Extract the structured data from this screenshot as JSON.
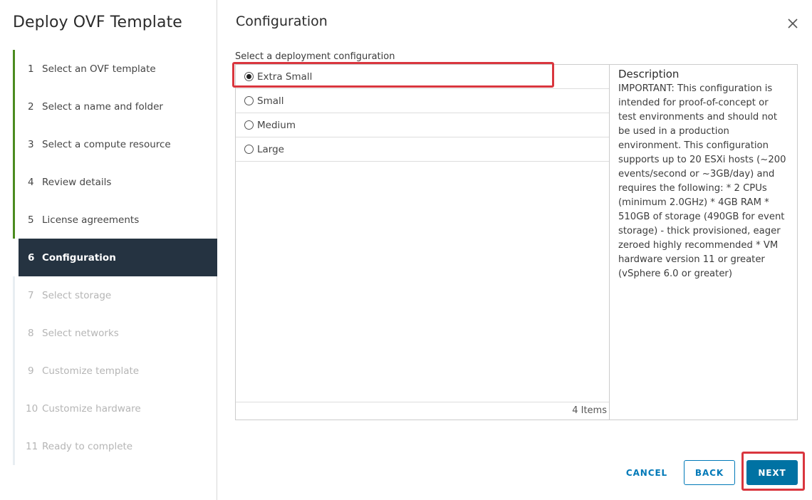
{
  "wizard": {
    "title": "Deploy OVF Template",
    "steps": [
      {
        "num": "1",
        "label": "Select an OVF template",
        "state": "done"
      },
      {
        "num": "2",
        "label": "Select a name and folder",
        "state": "done"
      },
      {
        "num": "3",
        "label": "Select a compute resource",
        "state": "done"
      },
      {
        "num": "4",
        "label": "Review details",
        "state": "done"
      },
      {
        "num": "5",
        "label": "License agreements",
        "state": "done"
      },
      {
        "num": "6",
        "label": "Configuration",
        "state": "active"
      },
      {
        "num": "7",
        "label": "Select storage",
        "state": "pending"
      },
      {
        "num": "8",
        "label": "Select networks",
        "state": "pending"
      },
      {
        "num": "9",
        "label": "Customize template",
        "state": "pending"
      },
      {
        "num": "10",
        "label": "Customize hardware",
        "state": "pending"
      },
      {
        "num": "11",
        "label": "Ready to complete",
        "state": "pending"
      }
    ]
  },
  "main": {
    "title": "Configuration",
    "section_label": "Select a deployment configuration",
    "options": [
      {
        "label": "Extra Small",
        "selected": true
      },
      {
        "label": "Small",
        "selected": false
      },
      {
        "label": "Medium",
        "selected": false
      },
      {
        "label": "Large",
        "selected": false
      }
    ],
    "item_count": "4 Items",
    "description": {
      "title": "Description",
      "text": "IMPORTANT: This configuration is intended for proof-of-concept or test environments and should not be used in a production environment. This configuration supports up to 20 ESXi hosts (~200 events/second or ~3GB/day) and requires the following: * 2 CPUs (minimum 2.0GHz) * 4GB RAM * 510GB of storage (490GB for event storage) - thick provisioned, eager zeroed highly recommended * VM hardware version 11 or greater (vSphere 6.0 or greater)"
    }
  },
  "footer": {
    "cancel_label": "CANCEL",
    "back_label": "BACK",
    "next_label": "NEXT"
  },
  "icons": {
    "close": "close-icon"
  },
  "colors": {
    "active_step_bg": "#253341",
    "done_step_bar": "#4b8b1f",
    "primary": "#0072a3",
    "highlight": "#d9363e"
  }
}
